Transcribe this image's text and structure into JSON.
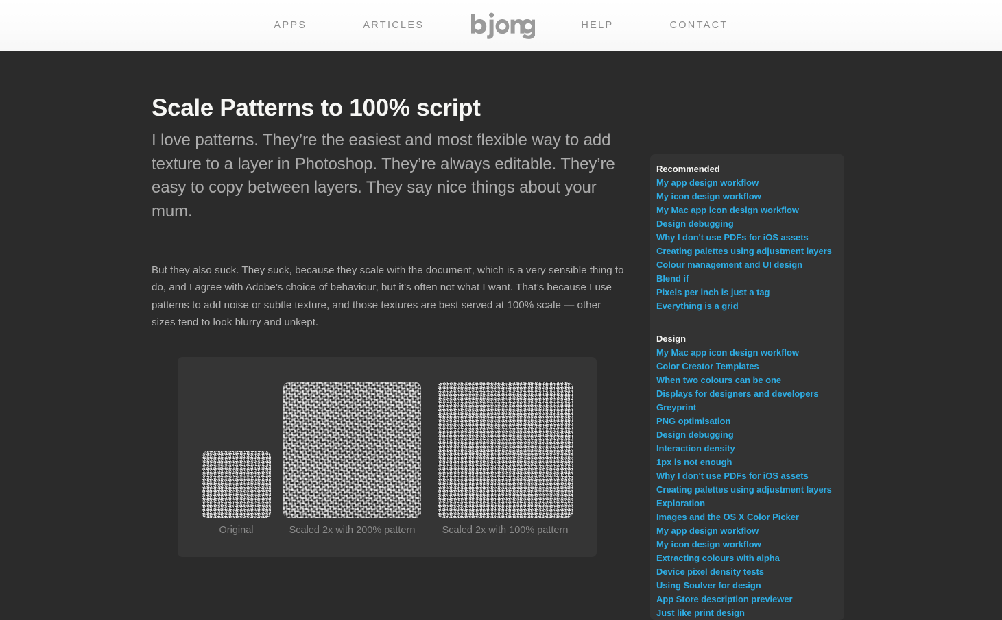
{
  "header": {
    "logo_label": "bjango",
    "nav_left": [
      {
        "label": "Apps"
      },
      {
        "label": "Articles"
      }
    ],
    "nav_right": [
      {
        "label": "Help"
      },
      {
        "label": "Contact"
      }
    ]
  },
  "article": {
    "title": "Scale Patterns to 100% script",
    "standfirst": "I love patterns. They’re the easiest and most flexible way to add texture to a layer in Photoshop. They’re always editable. They’re easy to copy between layers. They say nice things about your mum.",
    "body": "But they also suck. They suck, because they scale with the document, which is a very sensible thing to do, and I agree with Adobe’s choice of behaviour, but it’s often not what I want. That’s because I use patterns to add noise or subtle texture, and those textures are best served at 100% scale — other sizes tend to look blurry and unkept."
  },
  "figure": {
    "samples": [
      {
        "caption": "Original",
        "texture": "fine"
      },
      {
        "caption": "Scaled 2x with 200% pattern",
        "texture": "coarse"
      },
      {
        "caption": "Scaled 2x with 100% pattern",
        "texture": "fine"
      }
    ]
  },
  "sidebar": {
    "sections": [
      {
        "heading": "Recommended",
        "links": [
          "My app design workflow",
          "My icon design workflow",
          "My Mac app icon design workflow",
          "Design debugging",
          "Why I don't use PDFs for iOS assets",
          "Creating palettes using adjustment layers",
          "Colour management and UI design",
          "Blend if",
          "Pixels per inch is just a tag",
          "Everything is a grid"
        ]
      },
      {
        "heading": "Design",
        "links": [
          "My Mac app icon design workflow",
          "Color Creator Templates",
          "When two colours can be one",
          "Displays for designers and developers",
          "Greyprint",
          "PNG optimisation",
          "Design debugging",
          "Interaction density",
          "1px is not enough",
          "Why I don't use PDFs for iOS assets",
          "Creating palettes using adjustment layers",
          "Exploration",
          "Images and the OS X Color Picker",
          "My app design workflow",
          "My icon design workflow",
          "Extracting colours with alpha",
          "Device pixel density tests",
          "Using Soulver for design",
          "App Store description previewer",
          "Just like print design"
        ]
      }
    ]
  },
  "colors": {
    "page_background": "#2b2b2b",
    "header_background": "#fafafa",
    "panel_background": "#333333",
    "figure_background": "#353535",
    "link_blue": "#2eade4",
    "nav_gray": "#8d8d8d",
    "heading_white": "#f7f7f5",
    "body_gray": "#b4b4b4",
    "caption_gray": "#8b8b8b"
  }
}
